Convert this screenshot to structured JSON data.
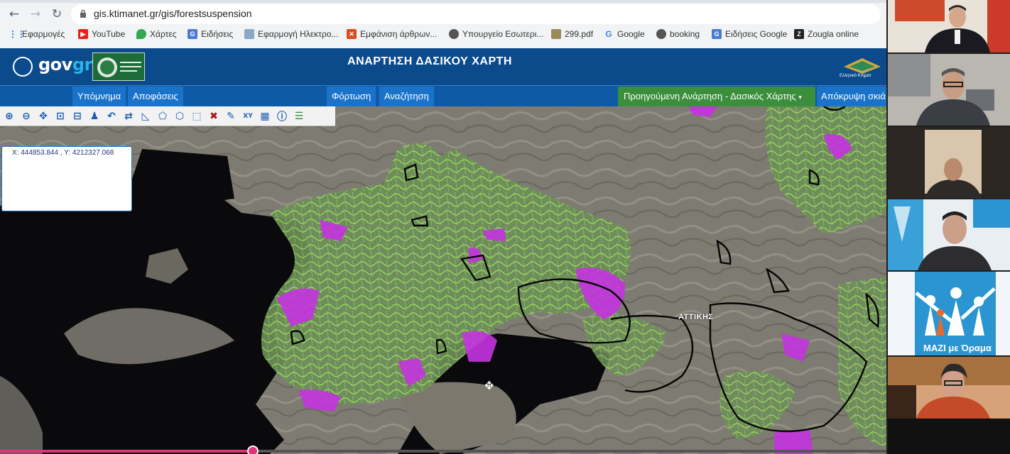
{
  "browser": {
    "url": "gis.ktimanet.gr/gis/forestsuspension",
    "bookmarks": [
      {
        "label": "Εφαρμογές",
        "icon": "apps-grid-icon"
      },
      {
        "label": "YouTube",
        "icon": "youtube-icon"
      },
      {
        "label": "Χάρτες",
        "icon": "maps-pin-icon"
      },
      {
        "label": "Ειδήσεις",
        "icon": "news-icon"
      },
      {
        "label": "Εφαρμογή Ηλεκτρο...",
        "icon": "app-icon"
      },
      {
        "label": "Εμφάνιση άρθρων...",
        "icon": "articles-icon"
      },
      {
        "label": "Υπουργείο Εσωτερι...",
        "icon": "globe-icon"
      },
      {
        "label": "299.pdf",
        "icon": "pdf-icon"
      },
      {
        "label": "Google",
        "icon": "google-icon"
      },
      {
        "label": "booking",
        "icon": "globe-icon"
      },
      {
        "label": "Ειδήσεις Google",
        "icon": "news-icon"
      },
      {
        "label": "Zougla online",
        "icon": "zougla-icon"
      }
    ]
  },
  "header": {
    "logo_prefix": "gov",
    "logo_suffix": "gr",
    "title": "ΑΝΑΡΤΗΣΗ ΔΑΣΙΚΟΥ ΧΑΡΤΗ",
    "agency_label": "Ελληνικό Κτηματ"
  },
  "menu": {
    "legend": "Υπόμνημα",
    "decisions": "Αποφάσεις",
    "loading": "Φόρτωση",
    "search": "Αναζήτηση",
    "previous_posting": "Προηγούμενη Ανάρτηση - Δασικός Χάρτης",
    "hide": "Απόκρυψη σκιά"
  },
  "toolbar": {
    "tools": [
      "zoom-in-icon",
      "zoom-out-icon",
      "pan-icon",
      "zoom-extent-icon",
      "zoom-box-icon",
      "identify-icon",
      "back-icon",
      "measure-line-icon",
      "measure-angle-icon",
      "polygon-icon",
      "select-polygon-icon",
      "select-icon",
      "clear-icon",
      "draw-icon",
      "xy-icon",
      "table-icon",
      "info-icon",
      "layers-icon"
    ]
  },
  "map": {
    "coordinates": "X: 444853.844 , Y: 4212327.068",
    "place_label": "ΑΤΤΙΚΗΣ",
    "video_progress": 0.285
  },
  "video_call": {
    "mazi_caption": "ΜΑΖΙ με Όραμα"
  },
  "colors": {
    "header_bg": "#0b4a8b",
    "menu_bg": "#0e5aa7",
    "menu_item_bg": "#1a73c9",
    "menu_green": "#3b8e3b",
    "forest_green": "#8bd44a",
    "purple_zone": "#c433e0"
  }
}
